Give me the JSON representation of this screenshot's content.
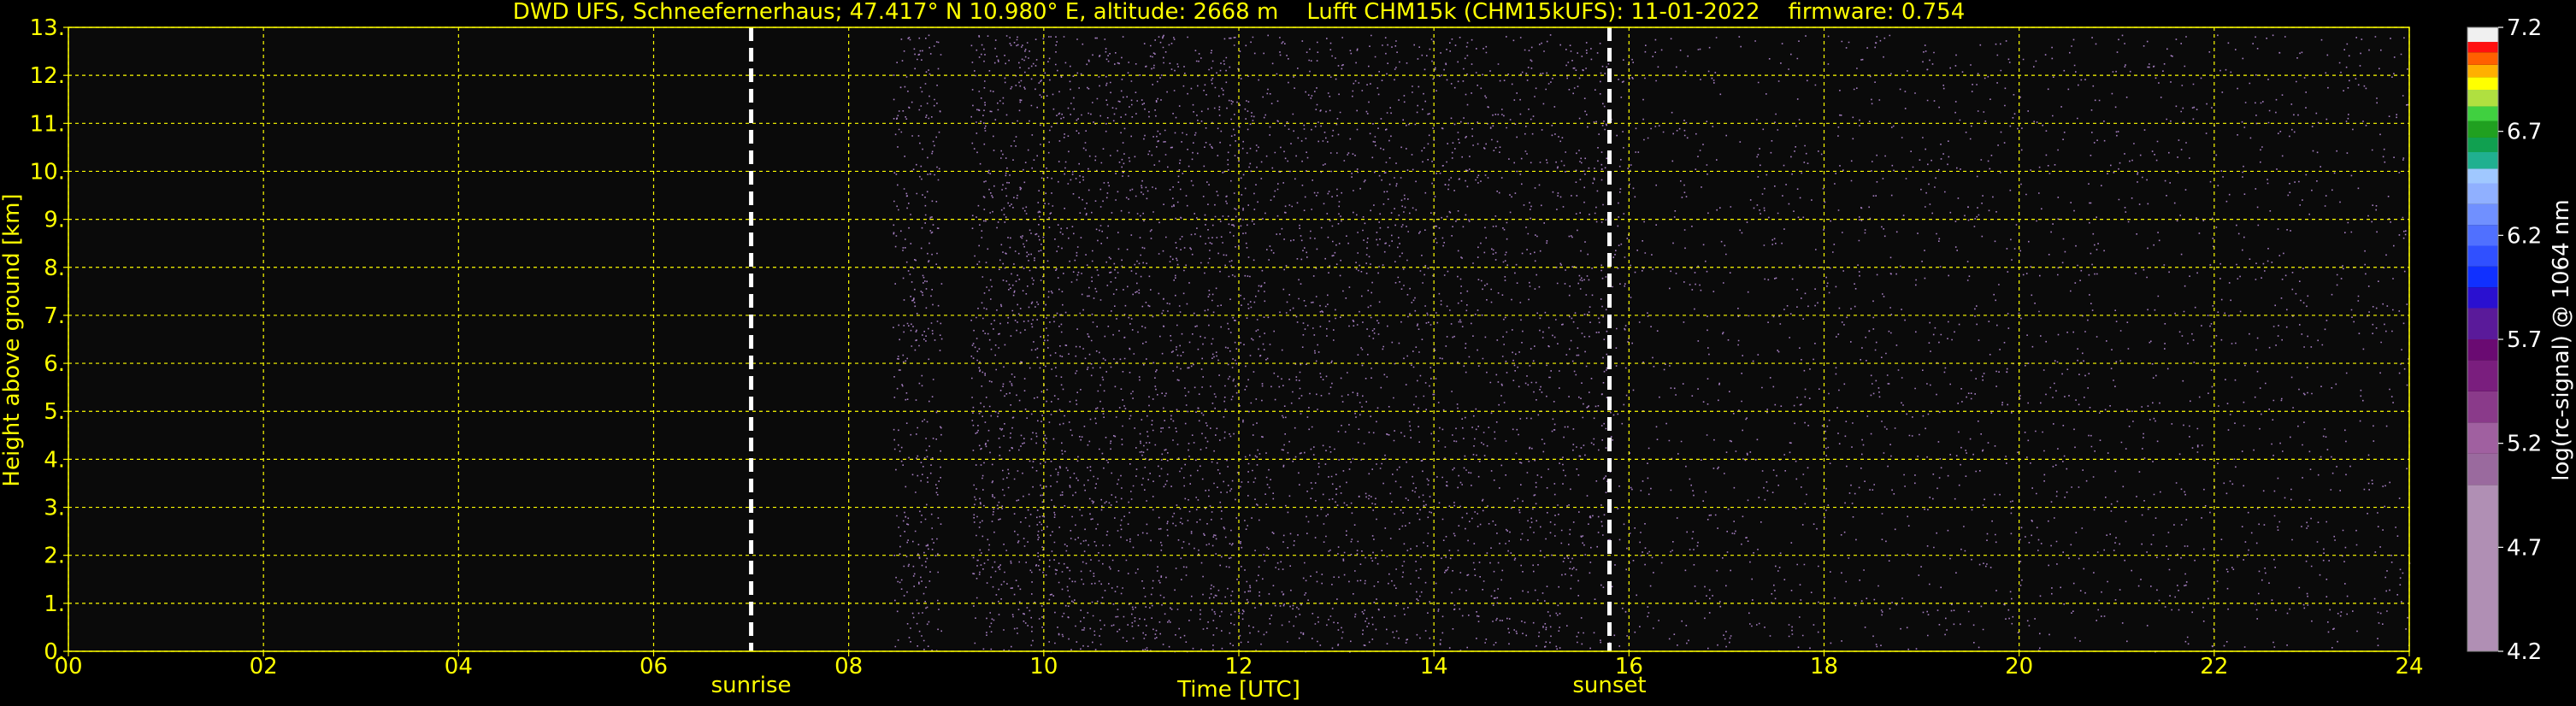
{
  "title": "DWD UFS, Schneefernerhaus; 47.417° N 10.980° E, altitude: 2668 m    Lufft CHM15k (CHM15kUFS): 11-01-2022    firmware: 0.754",
  "colors": {
    "background": "#000000",
    "grid": "#ffff00",
    "axis_text": "#ffff00",
    "colorbar_text": "#ffffff",
    "marker_line": "#ffffff",
    "signal_noise": "#d9a6ff"
  },
  "chart_data": {
    "type": "heatmap",
    "title": "DWD UFS, Schneefernerhaus; 47.417° N 10.980° E, altitude: 2668 m    Lufft CHM15k (CHM15kUFS): 11-01-2022    firmware: 0.754",
    "xlabel": "Time [UTC]",
    "ylabel": "Height above ground [km]",
    "xlim": [
      0,
      24
    ],
    "ylim": [
      0,
      13
    ],
    "x_ticks": [
      {
        "value": 0,
        "label": "00"
      },
      {
        "value": 2,
        "label": "02"
      },
      {
        "value": 4,
        "label": "04"
      },
      {
        "value": 6,
        "label": "06"
      },
      {
        "value": 8,
        "label": "08"
      },
      {
        "value": 10,
        "label": "10"
      },
      {
        "value": 12,
        "label": "12"
      },
      {
        "value": 14,
        "label": "14"
      },
      {
        "value": 16,
        "label": "16"
      },
      {
        "value": 18,
        "label": "18"
      },
      {
        "value": 20,
        "label": "20"
      },
      {
        "value": 22,
        "label": "22"
      },
      {
        "value": 24,
        "label": "24"
      }
    ],
    "y_ticks": [
      {
        "value": 0,
        "label": "0."
      },
      {
        "value": 1,
        "label": "1."
      },
      {
        "value": 2,
        "label": "2."
      },
      {
        "value": 3,
        "label": "3."
      },
      {
        "value": 4,
        "label": "4."
      },
      {
        "value": 5,
        "label": "5."
      },
      {
        "value": 6,
        "label": "6."
      },
      {
        "value": 7,
        "label": "7."
      },
      {
        "value": 8,
        "label": "8."
      },
      {
        "value": 9,
        "label": "9."
      },
      {
        "value": 10,
        "label": "10."
      },
      {
        "value": 11,
        "label": "11."
      },
      {
        "value": 12,
        "label": "12."
      },
      {
        "value": 13,
        "label": "13."
      }
    ],
    "grid": true,
    "markers": [
      {
        "label": "sunrise",
        "time": 7.0
      },
      {
        "label": "sunset",
        "time": 15.8
      }
    ],
    "signal_segments": [
      {
        "start": 8.45,
        "end": 8.95,
        "density": 0.9
      },
      {
        "start": 9.25,
        "end": 10.0,
        "density": 1.0
      },
      {
        "start": 10.0,
        "end": 12.0,
        "density": 0.85
      },
      {
        "start": 12.0,
        "end": 15.8,
        "density": 0.65
      },
      {
        "start": 15.8,
        "end": 24.0,
        "density": 0.3
      }
    ],
    "colorbar": {
      "label": "log(rc-signal) @ 1064 nm",
      "min": 4.2,
      "max": 7.2,
      "ticks": [
        {
          "value": 4.2,
          "label": "4.2"
        },
        {
          "value": 4.7,
          "label": "4.7"
        },
        {
          "value": 5.2,
          "label": "5.2"
        },
        {
          "value": 5.7,
          "label": "5.7"
        },
        {
          "value": 6.2,
          "label": "6.2"
        },
        {
          "value": 6.7,
          "label": "6.7"
        },
        {
          "value": 7.2,
          "label": "7.2"
        }
      ],
      "bands": [
        {
          "from": 4.2,
          "to": 5.0,
          "color": "#b08fb4"
        },
        {
          "from": 5.0,
          "to": 5.15,
          "color": "#9a6a9e"
        },
        {
          "from": 5.15,
          "to": 5.3,
          "color": "#a060a0"
        },
        {
          "from": 5.3,
          "to": 5.45,
          "color": "#8a3a8a"
        },
        {
          "from": 5.45,
          "to": 5.6,
          "color": "#7a1e7e"
        },
        {
          "from": 5.6,
          "to": 5.7,
          "color": "#6a0a72"
        },
        {
          "from": 5.7,
          "to": 5.85,
          "color": "#5a1a9a"
        },
        {
          "from": 5.85,
          "to": 5.95,
          "color": "#2a10d0"
        },
        {
          "from": 5.95,
          "to": 6.05,
          "color": "#1030ff"
        },
        {
          "from": 6.05,
          "to": 6.15,
          "color": "#3050ff"
        },
        {
          "from": 6.15,
          "to": 6.25,
          "color": "#5070ff"
        },
        {
          "from": 6.25,
          "to": 6.35,
          "color": "#7090ff"
        },
        {
          "from": 6.35,
          "to": 6.45,
          "color": "#90b0ff"
        },
        {
          "from": 6.45,
          "to": 6.52,
          "color": "#a0c8ff"
        },
        {
          "from": 6.52,
          "to": 6.6,
          "color": "#20b090"
        },
        {
          "from": 6.6,
          "to": 6.67,
          "color": "#10a050"
        },
        {
          "from": 6.67,
          "to": 6.75,
          "color": "#20a020"
        },
        {
          "from": 6.75,
          "to": 6.82,
          "color": "#40d040"
        },
        {
          "from": 6.82,
          "to": 6.9,
          "color": "#b0e040"
        },
        {
          "from": 6.9,
          "to": 6.96,
          "color": "#ffff00"
        },
        {
          "from": 6.96,
          "to": 7.02,
          "color": "#ffb000"
        },
        {
          "from": 7.02,
          "to": 7.08,
          "color": "#ff6000"
        },
        {
          "from": 7.08,
          "to": 7.13,
          "color": "#ff1010"
        },
        {
          "from": 7.13,
          "to": 7.2,
          "color": "#f0f0f0"
        }
      ]
    }
  }
}
